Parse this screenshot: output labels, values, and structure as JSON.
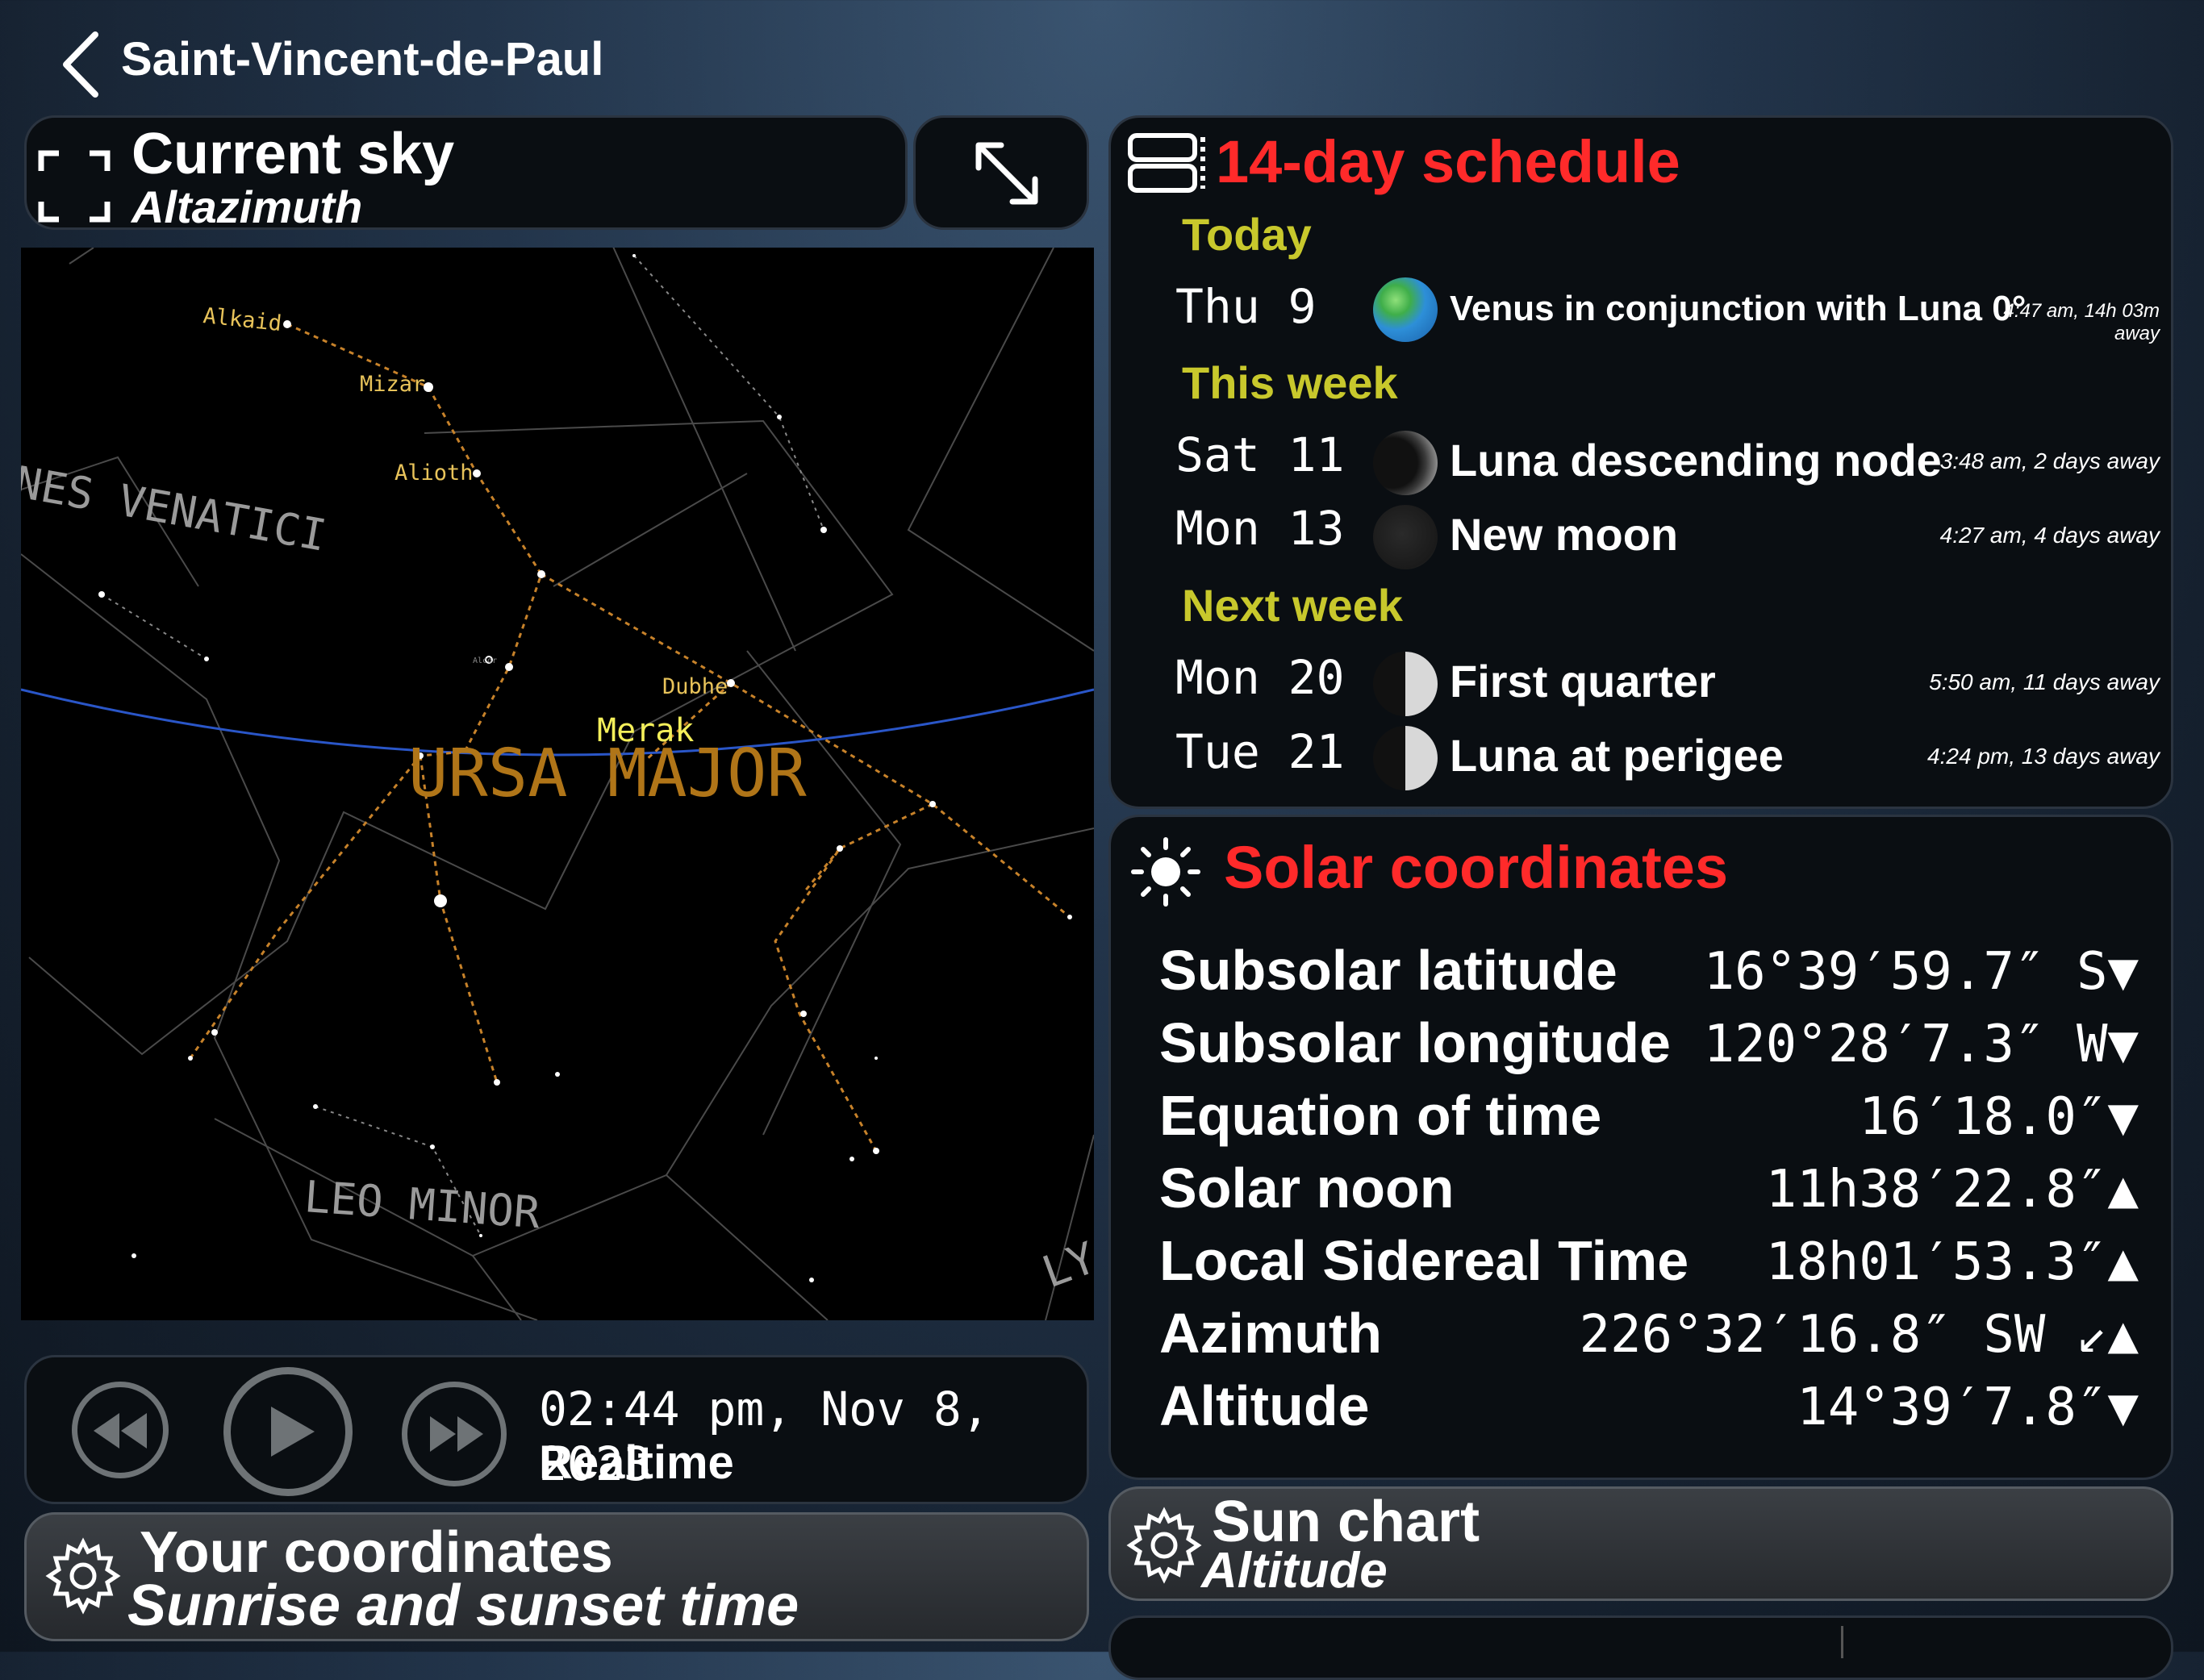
{
  "header": {
    "title": "Saint-Vincent-de-Paul"
  },
  "sky_panel": {
    "title": "Current sky",
    "subtitle": "Altazimuth"
  },
  "sky_map": {
    "constellations": [
      "NES VENATICI",
      "URSA MAJOR",
      "LEO MINOR",
      "LY"
    ],
    "stars": [
      "Alkaid",
      "Mizar",
      "Alioth",
      "Dubhe",
      "Merak"
    ],
    "tiny_label": "Alcor"
  },
  "time_control": {
    "datetime": "02:44 pm, Nov 8, 2023",
    "mode": "Realtime"
  },
  "coords_panel": {
    "title": "Your coordinates",
    "subtitle": "Sunrise and sunset time"
  },
  "schedule": {
    "title": "14-day schedule",
    "groups": [
      {
        "heading": "Today",
        "events": [
          {
            "date": "Thu 9",
            "icon": "earth-icon",
            "event": "Venus in conjunction with Luna 0°",
            "time": "4:47 am, 14h 03m away"
          }
        ]
      },
      {
        "heading": "This week",
        "events": [
          {
            "date": "Sat 11",
            "icon": "moon-crescent-icon",
            "event": "Luna descending node",
            "time": "3:48 am, 2 days away"
          },
          {
            "date": "Mon 13",
            "icon": "new-moon-icon",
            "event": "New moon",
            "time": "4:27 am, 4 days away"
          }
        ]
      },
      {
        "heading": "Next week",
        "events": [
          {
            "date": "Mon 20",
            "icon": "first-quarter-moon-icon",
            "event": "First quarter",
            "time": "5:50 am, 11 days away"
          },
          {
            "date": "Tue 21",
            "icon": "first-quarter-moon-icon",
            "event": "Luna at perigee",
            "time": "4:24 pm, 13 days away"
          }
        ]
      }
    ]
  },
  "solar": {
    "title": "Solar coordinates",
    "rows": [
      {
        "label": "Subsolar latitude",
        "value": "16°39′59.7″ S▼"
      },
      {
        "label": "Subsolar longitude",
        "value": "120°28′7.3″ W▼"
      },
      {
        "label": "Equation of time",
        "value": "16′18.0″▼"
      },
      {
        "label": "Solar noon",
        "value": "11h38′22.8″▲"
      },
      {
        "label": "Local Sidereal Time",
        "value": "18h01′53.3″▲"
      },
      {
        "label": "Azimuth",
        "value": "226°32′16.8″ SW ↙▲"
      },
      {
        "label": "Altitude",
        "value": "14°39′7.8″▼"
      }
    ]
  },
  "sun_chart": {
    "title": "Sun chart",
    "subtitle": "Altitude"
  }
}
